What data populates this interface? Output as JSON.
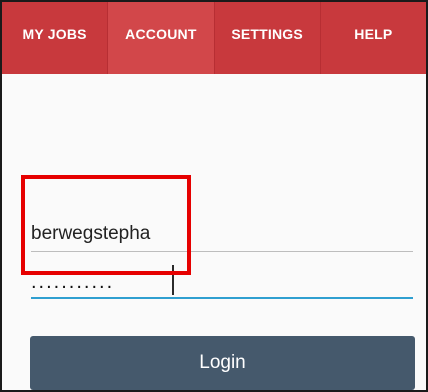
{
  "tabs": [
    {
      "label": "MY JOBS",
      "active": false
    },
    {
      "label": "ACCOUNT",
      "active": true
    },
    {
      "label": "SETTINGS",
      "active": false
    },
    {
      "label": "HELP",
      "active": false
    }
  ],
  "login_form": {
    "username_value": "berwegstepha",
    "password_value": "...........",
    "login_button_label": "Login"
  },
  "colors": {
    "tab_bar": "#c8393d",
    "tab_active": "#d2474a",
    "button": "#45596c",
    "focus_underline": "#2f9fd0",
    "annotation": "#e60000"
  }
}
